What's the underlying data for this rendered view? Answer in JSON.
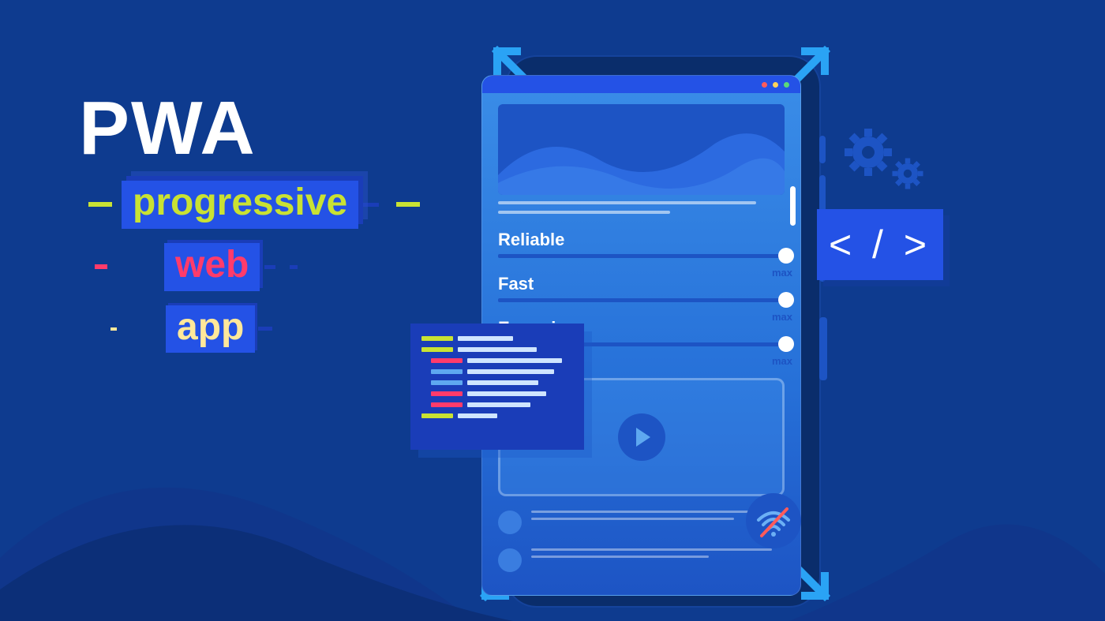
{
  "headline": {
    "title": "PWA",
    "words": [
      "progressive",
      "web",
      "app"
    ]
  },
  "features": [
    {
      "label": "Reliable",
      "max": "max"
    },
    {
      "label": "Fast",
      "max": "max"
    },
    {
      "label": "Engaging",
      "max": "max"
    }
  ],
  "code_badge": "< / >",
  "icons": {
    "play": "play-icon",
    "wifi_offline": "wifi-offline-icon",
    "gears": "gears-icon",
    "expand_arrows": "expand-arrow-icon"
  },
  "colors": {
    "bg": "#0e3b8f",
    "accent_blue": "#2452e6",
    "lime": "#c9e233",
    "pink": "#ff3b6b",
    "cream": "#ffe89a",
    "light_blue": "#5ea8f0"
  }
}
